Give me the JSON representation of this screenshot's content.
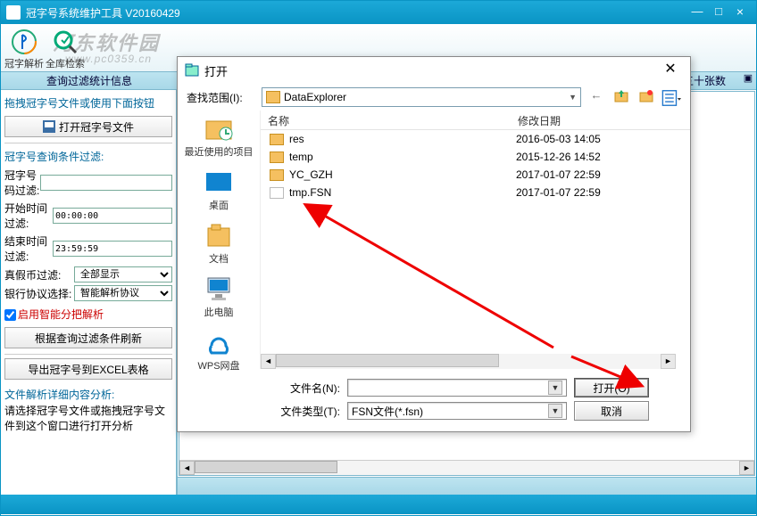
{
  "window": {
    "title": "冠字号系统维护工具 V20160429",
    "min": "—",
    "max": "□",
    "close": "×"
  },
  "watermark": {
    "main": "河东软件园",
    "sub": "www.pc0359.cn"
  },
  "toolbar": {
    "parse": "冠字解析",
    "search": "全库检索"
  },
  "header": {
    "stats": "查询过滤统计信息",
    "fifty": "五十张数",
    "ctl": "▣"
  },
  "left": {
    "hint1": "拖拽冠字号文件或使用下面按钮",
    "btn_open": "打开冠字号文件",
    "sect_filter": "冠字号查询条件过滤:",
    "lbl_code": "冠字号码过滤:",
    "lbl_start": "开始时间过滤:",
    "val_start": "00:00:00",
    "lbl_end": "结束时间过滤:",
    "val_end": "23:59:59",
    "lbl_tf": "真假币过滤:",
    "val_tf": "全部显示",
    "lbl_bank": "银行协议选择:",
    "val_bank": "智能解析协议",
    "chk_smart": "启用智能分把解析",
    "btn_refresh": "根据查询过滤条件刷新",
    "btn_export": "导出冠字号到EXCEL表格",
    "sect_detail": "文件解析详细内容分析:",
    "detail_text": "请选择冠字号文件或拖拽冠字号文件到这个窗口进行打开分析"
  },
  "dialog": {
    "title": "打开",
    "close": "✕",
    "look_in": "查找范围(I):",
    "folder": "DataExplorer",
    "places": {
      "recent": "最近使用的项目",
      "desktop": "桌面",
      "documents": "文档",
      "computer": "此电脑",
      "wps": "WPS网盘"
    },
    "cols": {
      "name": "名称",
      "date": "修改日期"
    },
    "files": [
      {
        "name": "res",
        "date": "2016-05-03 14:05",
        "type": "folder"
      },
      {
        "name": "temp",
        "date": "2015-12-26 14:52",
        "type": "folder"
      },
      {
        "name": "YC_GZH",
        "date": "2017-01-07 22:59",
        "type": "folder"
      },
      {
        "name": "tmp.FSN",
        "date": "2017-01-07 22:59",
        "type": "file"
      }
    ],
    "fn_label": "文件名(N):",
    "ft_label": "文件类型(T):",
    "ft_value": "FSN文件(*.fsn)",
    "open_btn": "打开(O)",
    "cancel_btn": "取消"
  }
}
